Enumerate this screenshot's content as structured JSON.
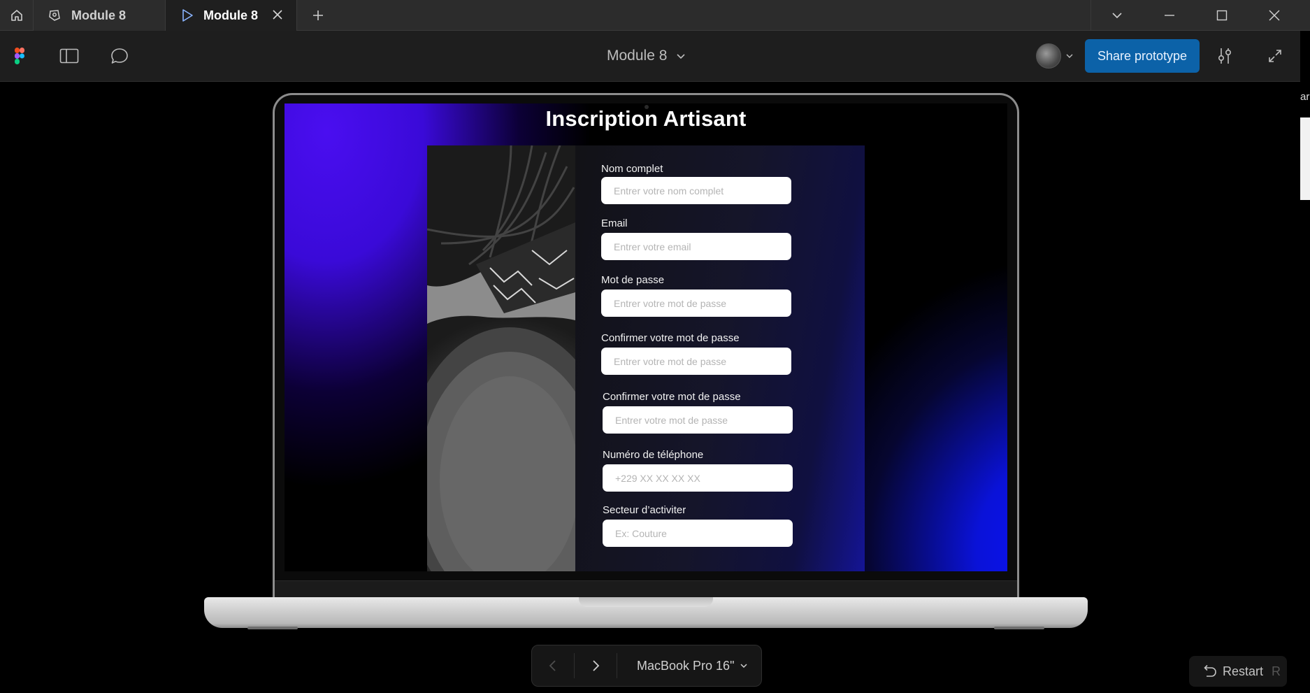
{
  "tabs": [
    {
      "label": "Module 8",
      "active": false
    },
    {
      "label": "Module 8",
      "active": true
    }
  ],
  "toolbar": {
    "file_title": "Module 8",
    "share_label": "Share prototype"
  },
  "right_sliver_text": "arl",
  "screen": {
    "title": "Inscription Artisant",
    "fields": [
      {
        "label": "Nom complet",
        "placeholder": "Entrer votre nom complet"
      },
      {
        "label": "Email",
        "placeholder": "Entrer votre email"
      },
      {
        "label": "Mot de passe",
        "placeholder": "Entrer votre mot de passe"
      },
      {
        "label": "Confirmer votre mot de passe",
        "placeholder": "Entrer votre mot de passe"
      },
      {
        "label": "Confirmer votre mot de passe",
        "placeholder": "Entrer votre mot de passe"
      },
      {
        "label": "Numéro de téléphone",
        "placeholder": "+229 XX XX XX XX"
      },
      {
        "label": "Secteur d’activiter",
        "placeholder": "Ex: Couture"
      }
    ]
  },
  "bottom": {
    "device_label": "MacBook Pro 16\"",
    "restart_label": "Restart",
    "restart_key": "R"
  },
  "icons": {
    "home": "home-icon",
    "figma_file": "figma-file-icon",
    "play": "play-icon",
    "close_tab": "close-icon",
    "add_tab": "plus-icon",
    "chevron": "chevron-down-icon",
    "minimize": "minimize-icon",
    "maximize": "maximize-icon",
    "close_window": "close-icon",
    "figma_logo": "figma-logo-icon",
    "sidebar": "sidebar-icon",
    "comment": "comment-icon",
    "settings": "settings-sliders-icon",
    "expand": "expand-icon",
    "prev": "chevron-left-icon",
    "next": "chevron-right-icon",
    "restart": "restart-icon"
  },
  "colors": {
    "accent_button": "#0c62a8",
    "gradient_purple": "#4a0ef0",
    "gradient_blue": "#0a12ff"
  }
}
